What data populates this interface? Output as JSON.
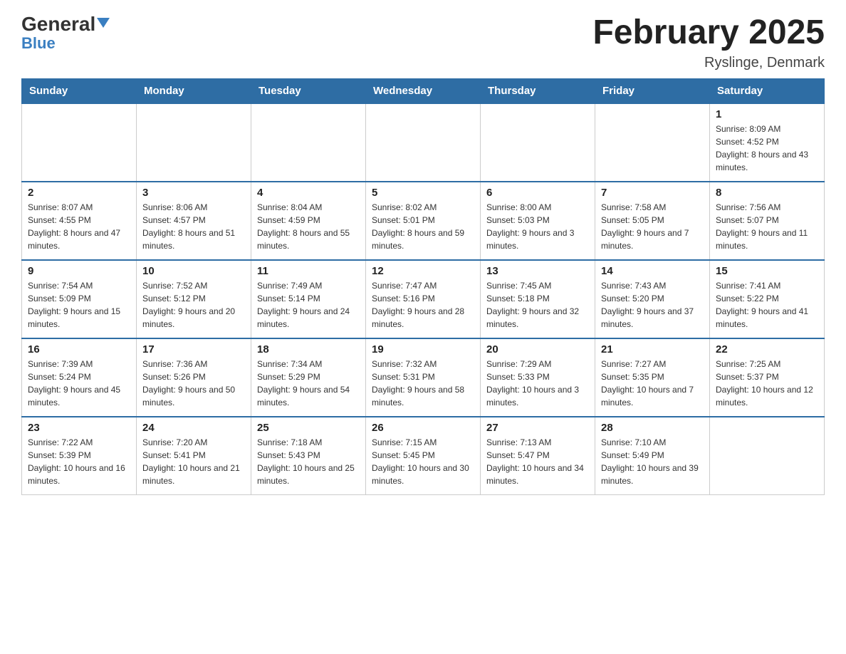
{
  "logo": {
    "general": "General",
    "blue": "Blue",
    "triangle": "▲"
  },
  "title": "February 2025",
  "location": "Ryslinge, Denmark",
  "weekdays": [
    "Sunday",
    "Monday",
    "Tuesday",
    "Wednesday",
    "Thursday",
    "Friday",
    "Saturday"
  ],
  "weeks": [
    [
      {
        "day": "",
        "info": ""
      },
      {
        "day": "",
        "info": ""
      },
      {
        "day": "",
        "info": ""
      },
      {
        "day": "",
        "info": ""
      },
      {
        "day": "",
        "info": ""
      },
      {
        "day": "",
        "info": ""
      },
      {
        "day": "1",
        "info": "Sunrise: 8:09 AM\nSunset: 4:52 PM\nDaylight: 8 hours and 43 minutes."
      }
    ],
    [
      {
        "day": "2",
        "info": "Sunrise: 8:07 AM\nSunset: 4:55 PM\nDaylight: 8 hours and 47 minutes."
      },
      {
        "day": "3",
        "info": "Sunrise: 8:06 AM\nSunset: 4:57 PM\nDaylight: 8 hours and 51 minutes."
      },
      {
        "day": "4",
        "info": "Sunrise: 8:04 AM\nSunset: 4:59 PM\nDaylight: 8 hours and 55 minutes."
      },
      {
        "day": "5",
        "info": "Sunrise: 8:02 AM\nSunset: 5:01 PM\nDaylight: 8 hours and 59 minutes."
      },
      {
        "day": "6",
        "info": "Sunrise: 8:00 AM\nSunset: 5:03 PM\nDaylight: 9 hours and 3 minutes."
      },
      {
        "day": "7",
        "info": "Sunrise: 7:58 AM\nSunset: 5:05 PM\nDaylight: 9 hours and 7 minutes."
      },
      {
        "day": "8",
        "info": "Sunrise: 7:56 AM\nSunset: 5:07 PM\nDaylight: 9 hours and 11 minutes."
      }
    ],
    [
      {
        "day": "9",
        "info": "Sunrise: 7:54 AM\nSunset: 5:09 PM\nDaylight: 9 hours and 15 minutes."
      },
      {
        "day": "10",
        "info": "Sunrise: 7:52 AM\nSunset: 5:12 PM\nDaylight: 9 hours and 20 minutes."
      },
      {
        "day": "11",
        "info": "Sunrise: 7:49 AM\nSunset: 5:14 PM\nDaylight: 9 hours and 24 minutes."
      },
      {
        "day": "12",
        "info": "Sunrise: 7:47 AM\nSunset: 5:16 PM\nDaylight: 9 hours and 28 minutes."
      },
      {
        "day": "13",
        "info": "Sunrise: 7:45 AM\nSunset: 5:18 PM\nDaylight: 9 hours and 32 minutes."
      },
      {
        "day": "14",
        "info": "Sunrise: 7:43 AM\nSunset: 5:20 PM\nDaylight: 9 hours and 37 minutes."
      },
      {
        "day": "15",
        "info": "Sunrise: 7:41 AM\nSunset: 5:22 PM\nDaylight: 9 hours and 41 minutes."
      }
    ],
    [
      {
        "day": "16",
        "info": "Sunrise: 7:39 AM\nSunset: 5:24 PM\nDaylight: 9 hours and 45 minutes."
      },
      {
        "day": "17",
        "info": "Sunrise: 7:36 AM\nSunset: 5:26 PM\nDaylight: 9 hours and 50 minutes."
      },
      {
        "day": "18",
        "info": "Sunrise: 7:34 AM\nSunset: 5:29 PM\nDaylight: 9 hours and 54 minutes."
      },
      {
        "day": "19",
        "info": "Sunrise: 7:32 AM\nSunset: 5:31 PM\nDaylight: 9 hours and 58 minutes."
      },
      {
        "day": "20",
        "info": "Sunrise: 7:29 AM\nSunset: 5:33 PM\nDaylight: 10 hours and 3 minutes."
      },
      {
        "day": "21",
        "info": "Sunrise: 7:27 AM\nSunset: 5:35 PM\nDaylight: 10 hours and 7 minutes."
      },
      {
        "day": "22",
        "info": "Sunrise: 7:25 AM\nSunset: 5:37 PM\nDaylight: 10 hours and 12 minutes."
      }
    ],
    [
      {
        "day": "23",
        "info": "Sunrise: 7:22 AM\nSunset: 5:39 PM\nDaylight: 10 hours and 16 minutes."
      },
      {
        "day": "24",
        "info": "Sunrise: 7:20 AM\nSunset: 5:41 PM\nDaylight: 10 hours and 21 minutes."
      },
      {
        "day": "25",
        "info": "Sunrise: 7:18 AM\nSunset: 5:43 PM\nDaylight: 10 hours and 25 minutes."
      },
      {
        "day": "26",
        "info": "Sunrise: 7:15 AM\nSunset: 5:45 PM\nDaylight: 10 hours and 30 minutes."
      },
      {
        "day": "27",
        "info": "Sunrise: 7:13 AM\nSunset: 5:47 PM\nDaylight: 10 hours and 34 minutes."
      },
      {
        "day": "28",
        "info": "Sunrise: 7:10 AM\nSunset: 5:49 PM\nDaylight: 10 hours and 39 minutes."
      },
      {
        "day": "",
        "info": ""
      }
    ]
  ]
}
